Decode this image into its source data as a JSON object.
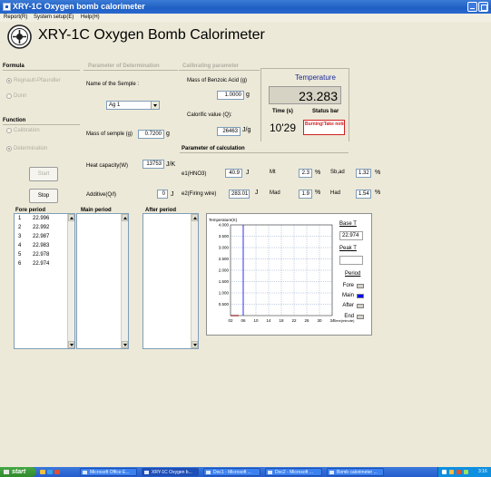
{
  "window": {
    "title": "XRY-1C Oxygen bomb calorimeter"
  },
  "menu": [
    "Report(R)",
    "System setup(E)",
    "Help(H)"
  ],
  "heading": "XRY-1C Oxygen Bomb Calorimeter",
  "formula": {
    "label": "Formula",
    "options": [
      {
        "label": "Regnault-Pfaundler",
        "selected": true
      },
      {
        "label": "Dunn",
        "selected": false
      }
    ]
  },
  "function": {
    "label": "Function",
    "options": [
      {
        "label": "Calibration",
        "selected": false
      },
      {
        "label": "Determination",
        "selected": true
      }
    ]
  },
  "buttons": {
    "start": "Start",
    "stop": "Stop"
  },
  "determination": {
    "label": "Parameter of Determination",
    "sample_name_label": "Name of the Semple :",
    "sample_name_value": "Ag 1",
    "sample_mass_label": "Mass of semple (g)",
    "sample_mass_value": "0.7200",
    "sample_mass_unit": "g",
    "heat_capacity_label": "Heat capacity(W)",
    "heat_capacity_value": "13753",
    "heat_capacity_unit": "J/K",
    "additive_label": "Additive(Q/l)",
    "additive_value": "0",
    "additive_unit": "J"
  },
  "calibrating": {
    "label": "Calibrating parameter",
    "benzoic_label": "Mass of Benzoic Acid (g)",
    "benzoic_value": "1.0000",
    "benzoic_unit": "g",
    "calorific_label": "Calorific value (Q):",
    "calorific_value": "26463",
    "calorific_unit": "J/g"
  },
  "calculation": {
    "label": "Parameter of calculation",
    "fields": [
      {
        "label": "e1(HNO3)",
        "value": "40.9",
        "unit": "J"
      },
      {
        "label": "Mt",
        "value": "2.3",
        "unit": "%"
      },
      {
        "label": "Sb,ad",
        "value": "1.32",
        "unit": "%"
      },
      {
        "label": "e2(Firing wire)",
        "value": "283.01",
        "unit": "J"
      },
      {
        "label": "Mad",
        "value": "1.9",
        "unit": "%"
      },
      {
        "label": "Had",
        "value": "1.54",
        "unit": "%"
      }
    ]
  },
  "temperature": {
    "label": "Temperature",
    "value": "23.283",
    "time_label": "Time (s)",
    "time_value": "10'29",
    "status_label": "Status bar",
    "status_text": "Burning!Take notice!"
  },
  "periods": [
    {
      "label": "Fore period",
      "rows": [
        {
          "idx": "1",
          "val": "22.996"
        },
        {
          "idx": "2",
          "val": "22.992"
        },
        {
          "idx": "3",
          "val": "22.987"
        },
        {
          "idx": "4",
          "val": "22.983"
        },
        {
          "idx": "5",
          "val": "22.978"
        },
        {
          "idx": "6",
          "val": "22.974"
        }
      ]
    },
    {
      "label": "Main period",
      "rows": []
    },
    {
      "label": "After period",
      "rows": []
    }
  ],
  "chart": {
    "y_axis_title": "Temperature(K)",
    "x_axis_title": "Time(minute)",
    "y_ticks": [
      "4.000",
      "3.500",
      "3.000",
      "2.500",
      "2.000",
      "1.500",
      "1.000",
      "0.500"
    ],
    "x_ticks": [
      "02",
      "06",
      "10",
      "14",
      "18",
      "22",
      "26",
      "30",
      "34"
    ],
    "base_t_label": "Base T",
    "base_t_value": "22.974",
    "peak_t_label": "Peak T",
    "peak_t_value": "",
    "period_label": "Period",
    "legend": [
      {
        "label": "Fore",
        "color": "#d4d0c8"
      },
      {
        "label": "Main",
        "color": "#0000ff"
      },
      {
        "label": "After",
        "color": "#d4d0c8"
      },
      {
        "label": "End",
        "color": "#d4d0c8"
      }
    ]
  },
  "taskbar": {
    "start": "start",
    "tasks": [
      "Microsoft Office E...",
      "XRY-1C Oxygen b...",
      "Doc1 - Microsoft ...",
      "Doc2 - Microsoft ...",
      "Bomb calorimeter ..."
    ],
    "clock": "3:16"
  }
}
